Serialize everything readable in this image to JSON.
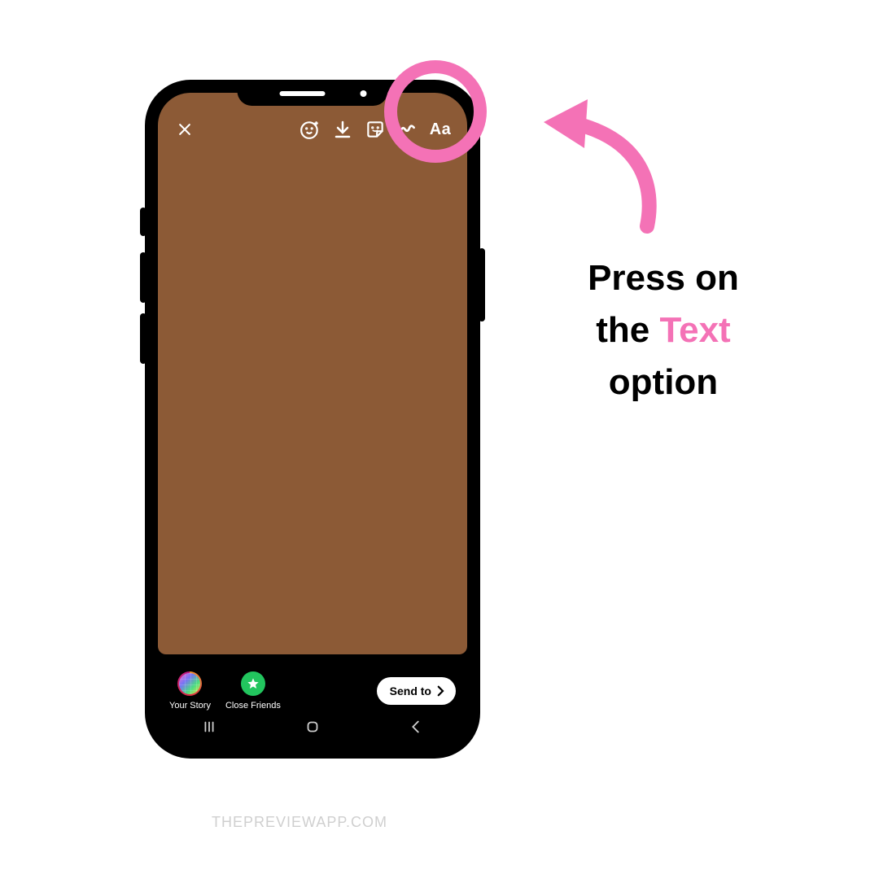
{
  "colors": {
    "highlight": "#f472b6",
    "story_background": "#8c5a36",
    "phone_frame": "#000000"
  },
  "toolbar": {
    "close_icon": "close",
    "effects_icon": "sparkle-face",
    "download_icon": "download",
    "sticker_icon": "sticker",
    "draw_icon": "scribble",
    "text_label": "Aa"
  },
  "share": {
    "your_story_label": "Your Story",
    "close_friends_label": "Close Friends",
    "send_to_label": "Send to"
  },
  "nav": {
    "recent_icon": "recent",
    "home_icon": "home",
    "back_icon": "back"
  },
  "instruction": {
    "part1": "Press on",
    "part2": "the",
    "highlighted": "Text",
    "part3": "option"
  },
  "watermark": "THEPREVIEWAPP.COM"
}
